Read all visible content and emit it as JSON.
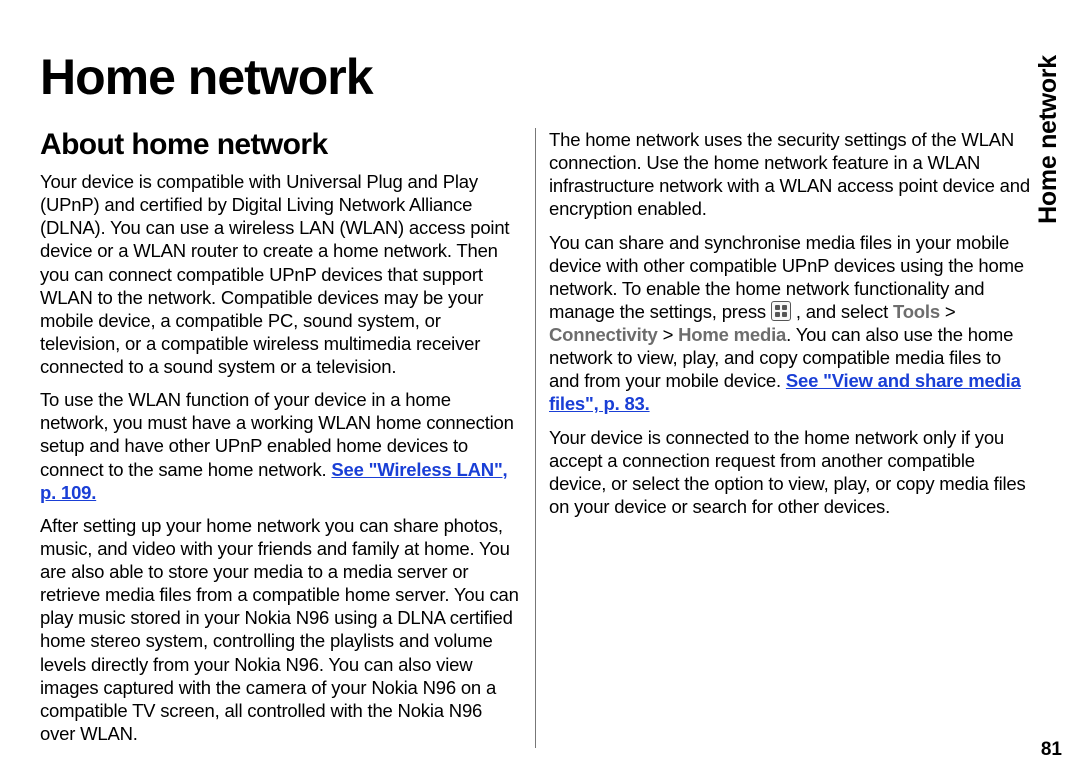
{
  "sideTab": "Home network",
  "pageNumber": "81",
  "title": "Home network",
  "subtitle": "About home network",
  "para1": "Your device is compatible with Universal Plug and Play (UPnP) and certified by Digital Living Network Alliance (DLNA). You can use a wireless LAN (WLAN) access point device or a WLAN router to create a home network. Then you can connect compatible UPnP devices that support WLAN to the network. Compatible devices may be your mobile device, a compatible PC, sound system, or television, or a compatible wireless multimedia receiver connected to a sound system or a television.",
  "para2a": "To use the WLAN function of your device in a home network, you must have a working WLAN home connection setup and have other UPnP enabled home devices to connect to the same home network. ",
  "link1": "See \"Wireless LAN\", p. 109.",
  "para3": "After setting up your home network you can share photos, music, and video with your friends and family at home. You are also able to store your media to a media server or retrieve media files from a compatible home server. You can play music stored in your Nokia N96 using a DLNA certified home stereo system, controlling the playlists and volume levels directly from your Nokia N96. You can also view images captured with the camera of your Nokia N96 on a compatible TV screen, all controlled with the Nokia N96 over WLAN.",
  "para4": "The home network uses the security settings of the WLAN connection. Use the home network feature in a WLAN infrastructure network with a WLAN access point device and encryption enabled.",
  "para5a": "You can share and synchronise media files in your mobile device with other compatible UPnP devices using the home network. To enable the home network functionality and manage the settings, press ",
  "para5b": " , and select ",
  "nav1": "Tools",
  "nav2": "Connectivity",
  "nav3": "Home media",
  "navSep": ">",
  "para5c": ". You can also use the home network to view, play, and copy compatible media files to and from your mobile device. ",
  "link2": "See \"View and share media files\", p. 83.",
  "para6": "Your device is connected to the home network only if you accept a connection request from another compatible device, or select the option to view, play, or copy media files on your device or search for other devices."
}
